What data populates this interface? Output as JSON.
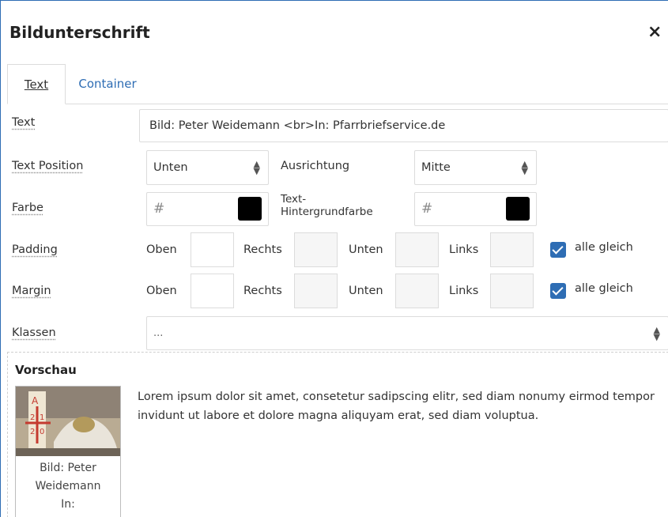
{
  "dialog": {
    "title": "Bildunterschrift",
    "close_glyph": "×"
  },
  "tabs": [
    {
      "label": "Text",
      "active": true
    },
    {
      "label": "Container",
      "active": false
    }
  ],
  "form": {
    "text": {
      "label": "Text",
      "value": "Bild: Peter Weidemann <br>In: Pfarrbriefservice.de"
    },
    "text_position": {
      "label": "Text Position",
      "value": "Unten"
    },
    "alignment": {
      "label": "Ausrichtung",
      "value": "Mitte"
    },
    "color": {
      "label": "Farbe",
      "placeholder": "#",
      "swatch": "#000000"
    },
    "bg_color": {
      "label_line1": "Text-",
      "label_line2": "Hintergrundfarbe",
      "placeholder": "#",
      "swatch": "#000000"
    },
    "padding": {
      "label": "Padding",
      "top": "Oben",
      "right": "Rechts",
      "bottom": "Unten",
      "left": "Links",
      "all_same": "alle gleich",
      "checked": true
    },
    "margin": {
      "label": "Margin",
      "top": "Oben",
      "right": "Rechts",
      "bottom": "Unten",
      "left": "Links",
      "all_same": "alle gleich",
      "checked": true
    },
    "classes": {
      "label": "Klassen",
      "value": "..."
    }
  },
  "preview": {
    "title": "Vorschau",
    "caption_line1": "Bild: Peter",
    "caption_line2": "Weidemann",
    "caption_line3": "In:",
    "text": "Lorem ipsum dolor sit amet, consetetur sadipscing elitr, sed diam nonumy eirmod tempor invidunt ut labore et dolore magna aliquyam erat, sed diam voluptua."
  },
  "colors": {
    "accent": "#2e6db4",
    "border": "#dcdcdc"
  }
}
